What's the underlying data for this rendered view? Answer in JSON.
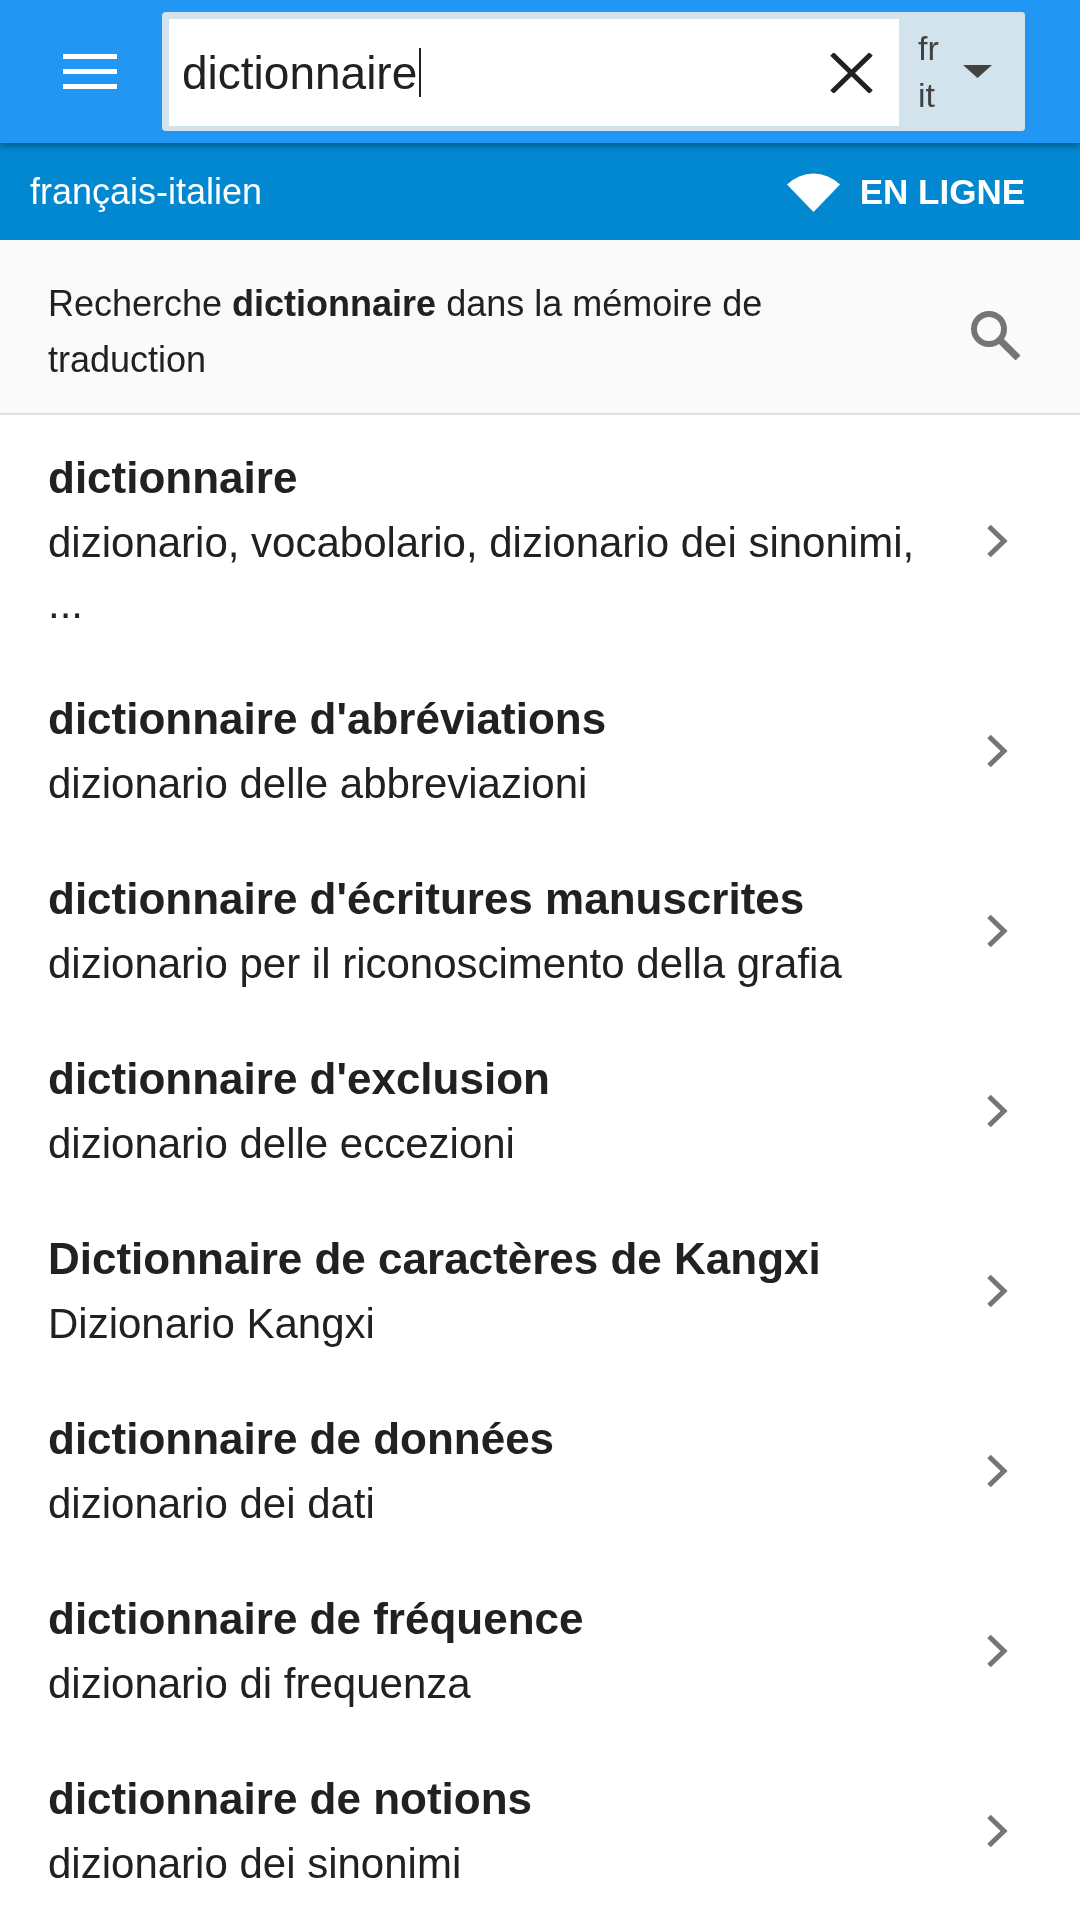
{
  "app_bar": {
    "search": {
      "value": "dictionnaire",
      "focused": true
    },
    "languages": {
      "source": "fr",
      "target": "it"
    }
  },
  "dictionary_bar": {
    "dictionary": "français-italien",
    "connection": "EN LIGNE"
  },
  "memory_search": {
    "text": "Recherche **dictionnaire** dans la mémoire de traduction"
  },
  "results": [
    {
      "term": "dictionnaire",
      "translation": "dizionario, vocabolario, dizionario dei sinonimi, ..."
    },
    {
      "term": "dictionnaire d'abréviations",
      "translation": "dizionario delle abbreviazioni"
    },
    {
      "term": "dictionnaire d'écritures manuscrites",
      "translation": "dizionario per il riconoscimento della grafia"
    },
    {
      "term": "dictionnaire d'exclusion",
      "translation": "dizionario delle eccezioni"
    },
    {
      "term": "Dictionnaire de caractères de Kangxi",
      "translation": "Dizionario Kangxi"
    },
    {
      "term": "dictionnaire de données",
      "translation": "dizionario dei dati"
    },
    {
      "term": "dictionnaire de fréquence",
      "translation": "dizionario di frequenza"
    },
    {
      "term": "dictionnaire de notions",
      "translation": "dizionario dei sinonimi"
    }
  ]
}
